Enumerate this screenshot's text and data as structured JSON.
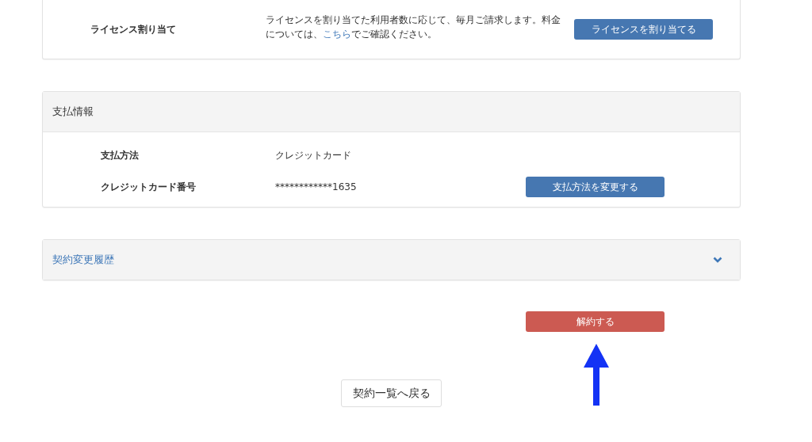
{
  "license": {
    "label": "ライセンス割り当て",
    "description_before": "ライセンスを割り当てた利用者数に応じて、毎月ご請求します。料金については、",
    "link": "こちら",
    "description_after": "でご確認ください。",
    "button": "ライセンスを割り当てる"
  },
  "payment": {
    "title": "支払情報",
    "rows": [
      {
        "label": "支払方法",
        "value": "クレジットカード"
      },
      {
        "label": "クレジットカード番号",
        "value": "************1635",
        "button": "支払方法を変更する"
      }
    ]
  },
  "history": {
    "title": "契約変更履歴",
    "expanded": false
  },
  "cancel_button": "解約する",
  "back_button": "契約一覧へ戻る"
}
